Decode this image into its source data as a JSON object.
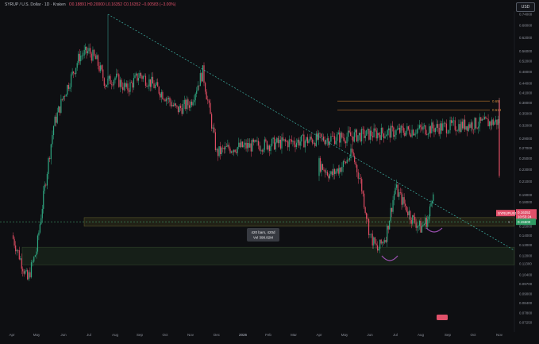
{
  "header": {
    "symbol_line": "SYRUP / U.S. Dollar · 1D · Kraken",
    "open": "O0.18891",
    "high": "H0.20000",
    "low": "L0.16352",
    "close": "C0.16352",
    "change": "−0.00583 (−3.00%)"
  },
  "currency_button": "USD",
  "chart_data": {
    "type": "candlestick",
    "ylabel": "",
    "xlabel": "",
    "scale": "log",
    "ylim": [
      0.07,
      0.74
    ],
    "y_ticks": [
      "0.74000",
      "0.68000",
      "0.62000",
      "0.56000",
      "0.52000",
      "0.48000",
      "0.44000",
      "0.41000",
      "0.38000",
      "0.35000",
      "0.32000",
      "0.29000",
      "0.27000",
      "0.25000",
      "0.23000",
      "0.21000",
      "0.19000",
      "0.18000",
      "0.16000",
      "0.15000",
      "0.14000",
      "0.13000",
      "0.12000",
      "0.11300",
      "0.10400",
      "0.09700",
      "0.09000",
      "0.08400",
      "0.07800",
      "0.07250"
    ],
    "x_ticks": [
      "Apr",
      "May",
      "Jun",
      "Jul",
      "Aug",
      "Sep",
      "Oct",
      "Nov",
      "Dec",
      "2026",
      "Feb",
      "Mar",
      "Apr",
      "May",
      "Jun",
      "Jul",
      "Aug",
      "Sep",
      "Oct",
      "Nov"
    ],
    "path_points": [
      [
        "Apr 1",
        0.14
      ],
      [
        "Apr 10",
        0.12
      ],
      [
        "Apr 20",
        0.1
      ],
      [
        "May 1",
        0.125
      ],
      [
        "May 10",
        0.2
      ],
      [
        "May 20",
        0.32
      ],
      [
        "Jun 1",
        0.4
      ],
      [
        "Jun 10",
        0.46
      ],
      [
        "Jun 20",
        0.54
      ],
      [
        "Jul 1",
        0.56
      ],
      [
        "Jul 10",
        0.52
      ],
      [
        "Jul 20",
        0.44
      ],
      [
        "Aug 1",
        0.46
      ],
      [
        "Aug 15",
        0.42
      ],
      [
        "Sep 1",
        0.47
      ],
      [
        "Sep 15",
        0.44
      ],
      [
        "Oct 1",
        0.4
      ],
      [
        "Oct 15",
        0.36
      ],
      [
        "Nov 1",
        0.38
      ],
      [
        "Nov 15",
        0.48
      ],
      [
        "Dec 1",
        0.26
      ],
      [
        "Dec 15",
        0.27
      ],
      [
        "Jan 1",
        0.33
      ],
      [
        "Jan 15",
        0.38
      ],
      [
        "Feb 1",
        0.36
      ],
      [
        "Feb 15",
        0.27
      ],
      [
        "Mar 1",
        0.22
      ],
      [
        "Mar 15",
        0.23
      ],
      [
        "Apr 1",
        0.24
      ],
      [
        "Apr 15",
        0.22
      ],
      [
        "May 1",
        0.24
      ],
      [
        "May 10",
        0.26
      ],
      [
        "May 20",
        0.21
      ],
      [
        "Jun 1",
        0.14
      ],
      [
        "Jun 10",
        0.125
      ],
      [
        "Jun 20",
        0.14
      ],
      [
        "Jul 1",
        0.2
      ],
      [
        "Jul 10",
        0.18
      ],
      [
        "Jul 20",
        0.16
      ],
      [
        "Aug 1",
        0.148
      ],
      [
        "Aug 10",
        0.16
      ],
      [
        "Aug 15",
        0.2
      ]
    ],
    "trendline": {
      "from": [
        "Jul 10",
        0.74
      ],
      "to": [
        "Nov",
        0.125
      ]
    },
    "fib_levels": [
      {
        "label": "0.65",
        "value": 0.385
      },
      {
        "label": "0.618",
        "value": 0.36
      }
    ],
    "support_zone": [
      0.15,
      0.16
    ],
    "support_line": 0.155,
    "demand_zone": [
      0.112,
      0.128
    ],
    "measure_box": {
      "line1": "420 bars, 420d",
      "line2": "Vol 398.82M"
    },
    "price_tag": {
      "symbol": "SYRUPUSD",
      "price": "0.16352",
      "countdown": "10:55:24"
    },
    "level_tag": "0.15500",
    "legend": "none",
    "grid": false
  }
}
